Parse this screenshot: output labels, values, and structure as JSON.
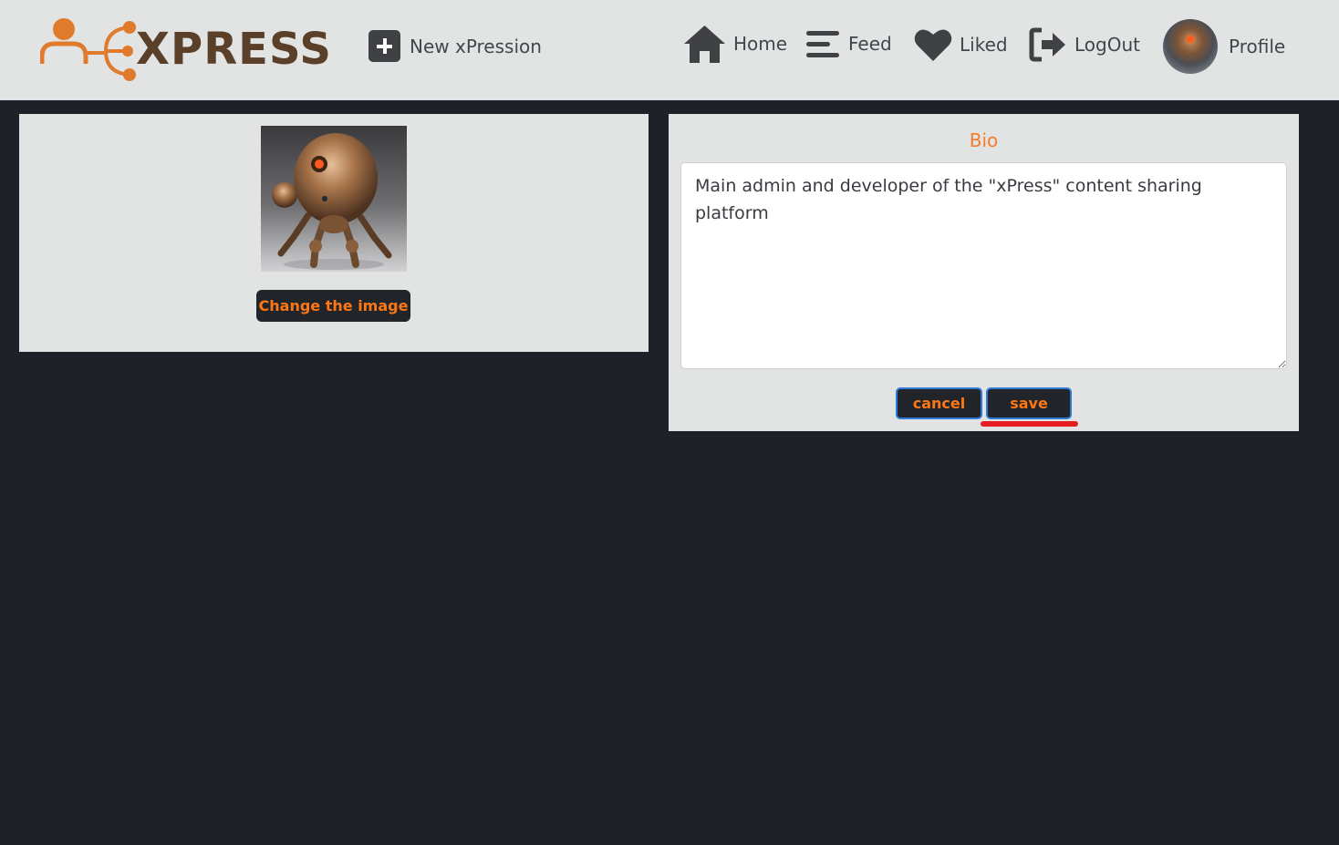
{
  "header": {
    "logo_text": "XPRESS",
    "new_label": "New xPression",
    "nav": [
      {
        "label": "Home",
        "icon": "home-icon"
      },
      {
        "label": "Feed",
        "icon": "feed-icon"
      },
      {
        "label": "Liked",
        "icon": "heart-icon"
      },
      {
        "label": "LogOut",
        "icon": "logout-icon"
      },
      {
        "label": "Profile",
        "icon": "avatar"
      }
    ]
  },
  "image_panel": {
    "change_button": "Change the image"
  },
  "bio_panel": {
    "title": "Bio",
    "text": "Main admin and developer of the \"xPress\" content sharing platform",
    "cancel_label": "cancel",
    "save_label": "save"
  },
  "colors": {
    "accent": "#fd7714",
    "header_bg": "#e2e3e3",
    "page_bg": "#1e2128",
    "highlight": "#e61e24"
  }
}
